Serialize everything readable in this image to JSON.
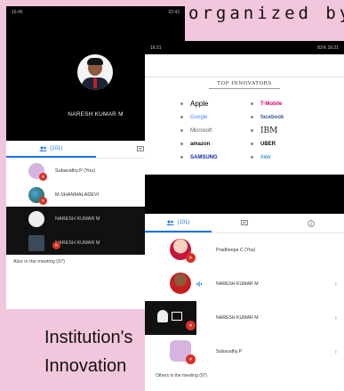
{
  "background": {
    "top_caption": "organized by",
    "left_line1": "Institution's",
    "left_line2": "Innovation"
  },
  "phone1": {
    "status_time": "16:45",
    "status_right": "02:42",
    "host_name": "NARESH KUMAR M",
    "tab_people_count": "(101)",
    "participants": [
      {
        "name": "Subavathy.P (You)"
      },
      {
        "name": "M.SHANMALADEVI"
      },
      {
        "name": "NARESH KUMAR M"
      },
      {
        "name": "NARESH KUMAR M"
      }
    ],
    "footer_text": "Also in the meeting (97)"
  },
  "phone2": {
    "status_left": "16:21",
    "status_right": "81% 16:21",
    "slide_title": "TOP INNOVATORS",
    "logos_left": [
      "Apple",
      "Google",
      "Microsoft",
      "amazon",
      "SAMSUNG"
    ],
    "logos_right": [
      "T-Mobile",
      "facebook",
      "IBM",
      "UBER",
      "Intel"
    ],
    "tab_people_count": "(101)",
    "participants": [
      {
        "name": "Pradheepa C (You)"
      },
      {
        "name": "NARESH KUMAR M"
      },
      {
        "name": "NARESH KUMAR M"
      },
      {
        "name": "Subavathy.P"
      }
    ],
    "footer_text": "Others in the meeting (97)"
  },
  "colors": {
    "accent": "#1a73e8",
    "mute": "#d93025",
    "bg_pink": "#f2c6dc"
  }
}
